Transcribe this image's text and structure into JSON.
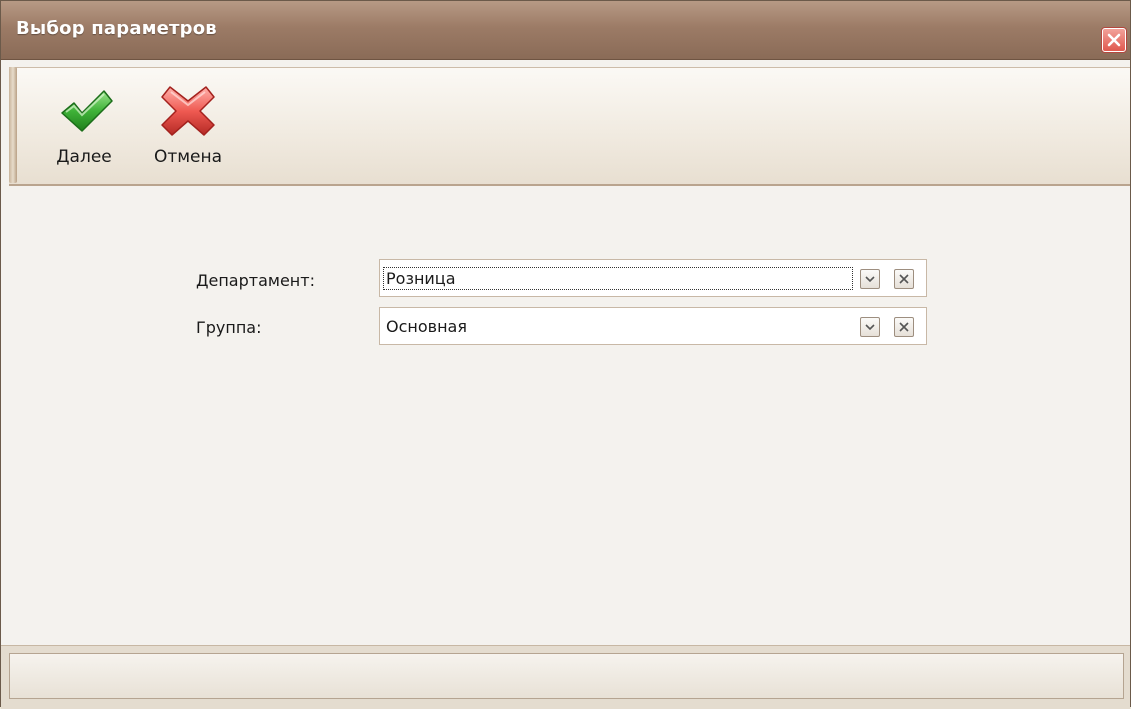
{
  "window": {
    "title": "Выбор параметров"
  },
  "toolbar": {
    "next_label": "Далее",
    "cancel_label": "Отмена"
  },
  "form": {
    "fields": [
      {
        "label": "Департамент:",
        "value": "Розница"
      },
      {
        "label": "Группа:",
        "value": "Основная"
      }
    ]
  },
  "icons": {
    "next": "checkmark-icon",
    "cancel": "red-x-icon",
    "close": "close-icon",
    "dropdown": "chevron-down-icon",
    "clear": "clear-x-icon"
  },
  "colors": {
    "titlebar": "#9c7b66",
    "accept": "#3aa832",
    "cancel": "#e04a44"
  }
}
